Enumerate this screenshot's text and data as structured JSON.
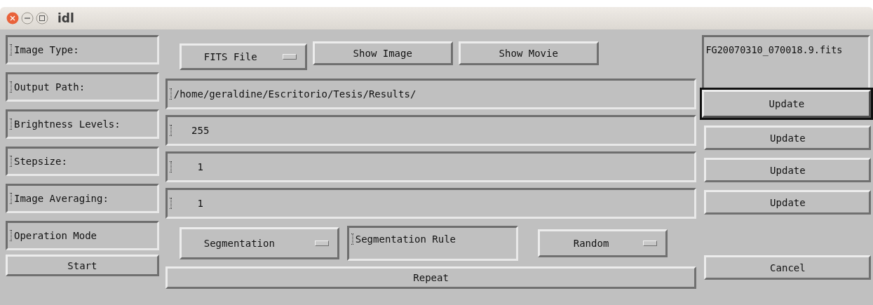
{
  "window": {
    "title": "idl"
  },
  "labels": [
    "Image Type:",
    "Output Path:",
    "Brightness Levels:",
    "Stepsize:",
    "Image Averaging:",
    "Operation Mode"
  ],
  "start_button": "Start",
  "image_type": {
    "value": "FITS File"
  },
  "top_buttons": [
    "Show Image",
    "Show Movie"
  ],
  "fields": [
    {
      "value": "/home/geraldine/Escritorio/Tesis/Results/"
    },
    {
      "value": "   255"
    },
    {
      "value": "    1"
    },
    {
      "value": "    1"
    }
  ],
  "mode": {
    "value": "Segmentation"
  },
  "rule_label": "Segmentation Rule",
  "rule": {
    "value": "Random"
  },
  "repeat_button": "Repeat",
  "file_name": "FG20070310_070018.9.fits",
  "update_buttons": [
    {
      "label": "Update",
      "focused": true
    },
    {
      "label": "Update",
      "focused": false
    },
    {
      "label": "Update",
      "focused": false
    },
    {
      "label": "Update",
      "focused": false
    }
  ],
  "cancel_button": "Cancel"
}
